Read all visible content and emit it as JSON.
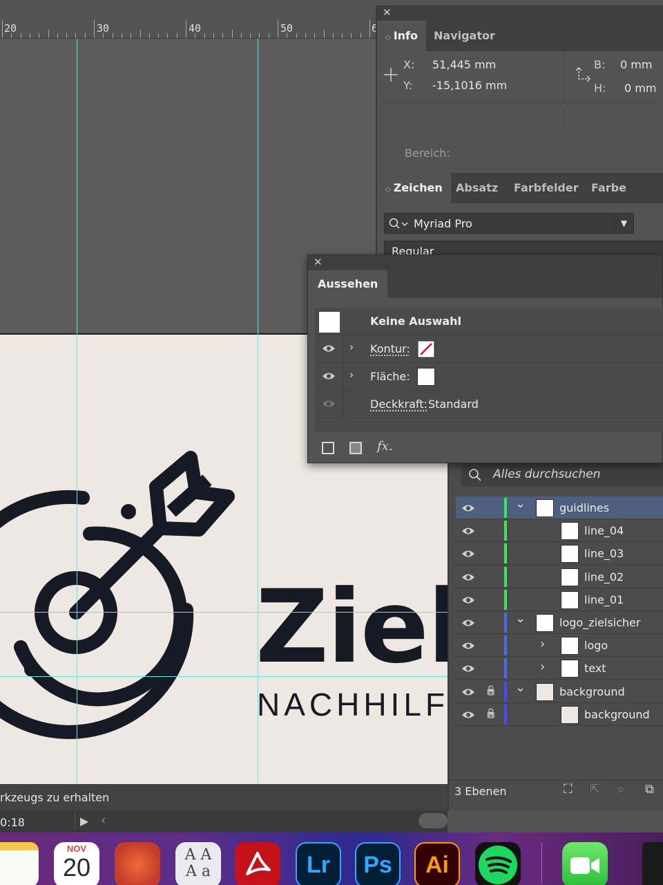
{
  "ruler": {
    "labels": [
      "20",
      "30",
      "40",
      "50",
      "6"
    ]
  },
  "info_panel": {
    "tabs": [
      "Info",
      "Navigator"
    ],
    "x_label": "X:",
    "x_value": "51,445 mm",
    "y_label": "Y:",
    "y_value": "-15,1016 mm",
    "b_label": "B:",
    "b_value": "0 mm",
    "h_label": "H:",
    "h_value": "0 mm",
    "bereich": "Bereich:"
  },
  "zeichen_panel": {
    "tabs": [
      "Zeichen",
      "Absatz",
      "Farbfelder",
      "Farbe"
    ],
    "font": "Myriad Pro",
    "style": "Regular"
  },
  "aussehen_panel": {
    "title": "Aussehen",
    "selection": "Keine Auswahl",
    "kontur": "Kontur:",
    "flaeche": "Fläche:",
    "deckkraft_label": "Deckkraft:",
    "deckkraft_value": "Standard",
    "fx": "fx."
  },
  "layers_panel": {
    "search_placeholder": "Alles durchsuchen",
    "layers": [
      {
        "name": "guidlines",
        "level": 0,
        "color": "#3ee65c",
        "expanded": true,
        "selected": true
      },
      {
        "name": "line_04",
        "level": 1,
        "color": "#3ee65c"
      },
      {
        "name": "line_03",
        "level": 1,
        "color": "#3ee65c"
      },
      {
        "name": "line_02",
        "level": 1,
        "color": "#3ee65c"
      },
      {
        "name": "line_01",
        "level": 1,
        "color": "#3ee65c"
      },
      {
        "name": "logo_zielsicher",
        "level": 0,
        "color": "#4a6cf0",
        "expanded": true
      },
      {
        "name": "logo",
        "level": 1,
        "color": "#4a6cf0",
        "collapsed": true
      },
      {
        "name": "text",
        "level": 1,
        "color": "#4a6cf0",
        "collapsed": true
      },
      {
        "name": "background",
        "level": 0,
        "color": "#4a4af0",
        "expanded": true,
        "locked": true
      },
      {
        "name": "background",
        "level": 1,
        "color": "#4a4af0",
        "locked": true
      }
    ],
    "count": "3 Ebenen"
  },
  "artboard": {
    "word1": "Ziel",
    "word2": "NACHHILFE"
  },
  "statusbar": {
    "hint": "rkzeugs zu erhalten",
    "time": "0:18"
  },
  "dock": {
    "calendar_month": "NOV",
    "calendar_day": "20",
    "lr": "Lr",
    "ps": "Ps",
    "ai": "Ai"
  }
}
